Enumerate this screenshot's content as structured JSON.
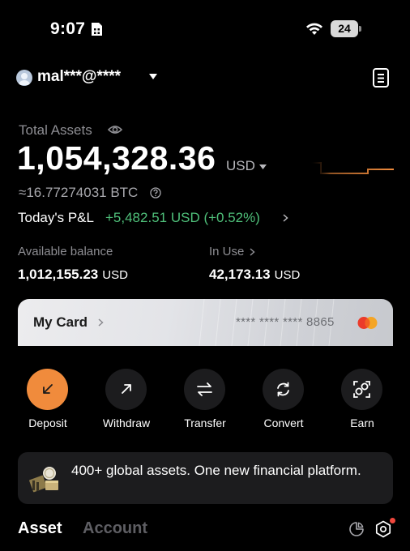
{
  "status_bar": {
    "time": "9:07",
    "battery": "24"
  },
  "account": {
    "email": "mal***@****"
  },
  "total": {
    "label": "Total Assets",
    "value": "1,054,328.36",
    "currency": "USD",
    "btc": "≈16.77274031 BTC",
    "pnl_label": "Today's P&L",
    "pnl_value": "+5,482.51 USD (+0.52%)"
  },
  "balances": {
    "available_label": "Available balance",
    "available_value": "1,012,155.23",
    "available_unit": "USD",
    "in_use_label": "In Use",
    "in_use_value": "42,173.13",
    "in_use_unit": "USD"
  },
  "card": {
    "title": "My Card",
    "number": "**** **** **** 8865"
  },
  "actions": [
    {
      "label": "Deposit",
      "icon": "arrow-down-left-icon"
    },
    {
      "label": "Withdraw",
      "icon": "arrow-up-right-icon"
    },
    {
      "label": "Transfer",
      "icon": "transfer-icon"
    },
    {
      "label": "Convert",
      "icon": "convert-icon"
    },
    {
      "label": "Earn",
      "icon": "earn-icon"
    }
  ],
  "promo": {
    "text": "400+ global assets. One new financial platform."
  },
  "tabs": {
    "asset": "Asset",
    "account": "Account"
  },
  "colors": {
    "accent": "#f08b3c",
    "positive": "#4fc07a",
    "background": "#000000",
    "surface": "#1c1c1e",
    "notification": "#f0473d"
  }
}
